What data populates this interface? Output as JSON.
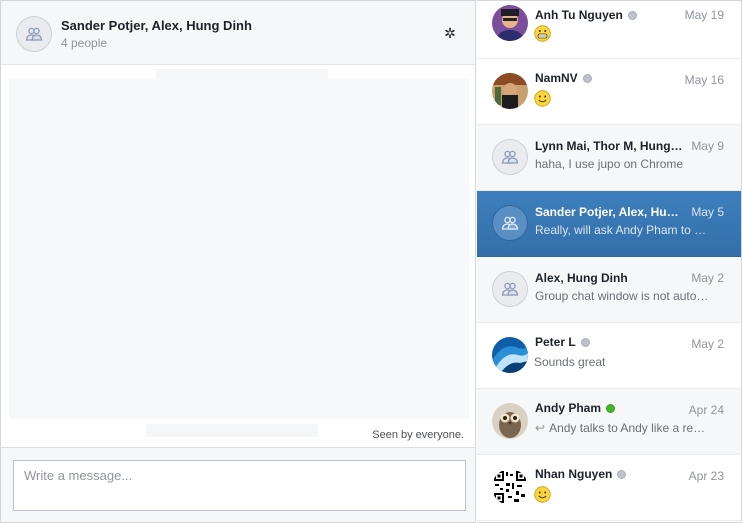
{
  "chat": {
    "title": "Sander Potjer, Alex, Hung Dinh",
    "subtitle": "4 people",
    "gear_glyph": "✲",
    "seen_text": "Seen by everyone.",
    "input_placeholder": "Write a message...",
    "input_value": ""
  },
  "conversations": [
    {
      "name": "Anh Tu Nguyen",
      "date": "May 19",
      "snippet": "",
      "emoji": "grin-emoji",
      "status": "offline",
      "avatar": "photo-avatar-1"
    },
    {
      "name": "NamNV",
      "date": "May 16",
      "snippet": "",
      "emoji": "smile-emoji",
      "status": "offline",
      "avatar": "photo-avatar-2"
    },
    {
      "name": "Lynn Mai, Thor M, Hung…",
      "date": "May 9",
      "snippet": "haha, I use jupo on Chrome",
      "avatar": "group-icon"
    },
    {
      "name": "Sander Potjer, Alex, Hu…",
      "date": "May 5",
      "snippet": "Really, will ask Andy Pham to …",
      "avatar": "group-icon",
      "selected": true
    },
    {
      "name": "Alex, Hung Dinh",
      "date": "May 2",
      "snippet": "Group chat window is not auto…",
      "avatar": "group-icon"
    },
    {
      "name": "Peter L",
      "date": "May 2",
      "snippet": "Sounds great",
      "status": "offline",
      "avatar": "photo-avatar-3"
    },
    {
      "name": "Andy Pham",
      "date": "Apr 24",
      "snippet": "Andy talks to Andy like a re…",
      "status": "online",
      "reply": true,
      "avatar": "photo-avatar-4"
    },
    {
      "name": "Nhan Nguyen",
      "date": "Apr 23",
      "snippet": "",
      "emoji": "smile-emoji",
      "status": "offline",
      "avatar": "photo-avatar-5"
    }
  ],
  "colors": {
    "selected_bg": "#3a7bb8",
    "online": "#42b72a",
    "offline": "#bec3c9"
  }
}
